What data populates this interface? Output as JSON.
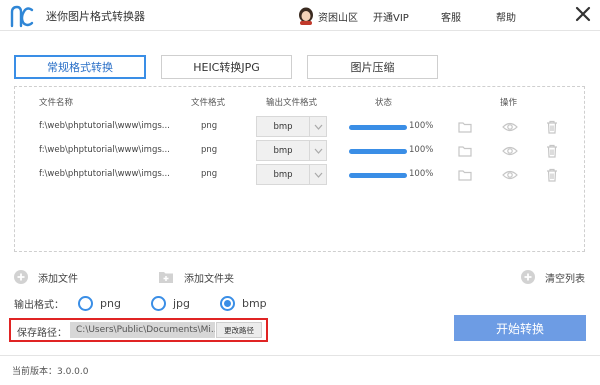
{
  "app": {
    "title": "迷你图片格式转换器"
  },
  "user": {
    "name": "资困山区"
  },
  "header": {
    "vip": "开通VIP",
    "service": "客服",
    "help": "帮助"
  },
  "tabs": [
    {
      "label": "常规格式转换",
      "active": true
    },
    {
      "label": "HEIC转换JPG",
      "active": false
    },
    {
      "label": "图片压缩",
      "active": false
    }
  ],
  "table": {
    "columns": {
      "name": "文件名称",
      "format": "文件格式",
      "output": "输出文件格式",
      "status": "状态",
      "actions": "操作"
    },
    "rows": [
      {
        "name": "f:\\web\\phptutorial\\www\\imgs...",
        "format": "png",
        "output": "bmp",
        "progress": 100,
        "progress_text": "100%"
      },
      {
        "name": "f:\\web\\phptutorial\\www\\imgs...",
        "format": "png",
        "output": "bmp",
        "progress": 100,
        "progress_text": "100%"
      },
      {
        "name": "f:\\web\\phptutorial\\www\\imgs...",
        "format": "png",
        "output": "bmp",
        "progress": 100,
        "progress_text": "100%"
      }
    ]
  },
  "actions": {
    "add_file": "添加文件",
    "add_folder": "添加文件夹",
    "clear_list": "清空列表"
  },
  "output_format": {
    "label": "输出格式：",
    "options": [
      "png",
      "jpg",
      "bmp"
    ],
    "selected": "bmp"
  },
  "save": {
    "label": "保存路径：",
    "path": "C:\\Users\\Public\\Documents\\Mi...",
    "change_label": "更改路径"
  },
  "start_button": "开始转换",
  "footer": {
    "version": "当前版本：3.0.0.0"
  },
  "colors": {
    "accent": "#3a8ee6",
    "start_button": "#6d9ce4",
    "highlight_border": "#e02424"
  }
}
